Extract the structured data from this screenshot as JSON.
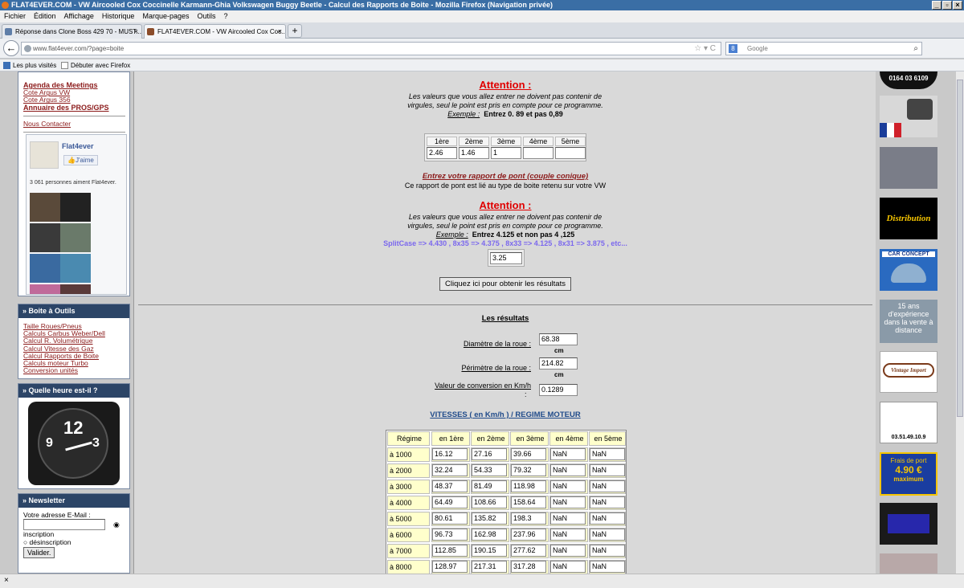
{
  "window": {
    "title": "FLAT4EVER.COM - VW Aircooled Cox Coccinelle Karmann-Ghia Volkswagen Buggy Beetle - Calcul des Rapports de Boite - Mozilla Firefox (Navigation privée)"
  },
  "menu": [
    "Fichier",
    "Édition",
    "Affichage",
    "Historique",
    "Marque-pages",
    "Outils",
    "?"
  ],
  "tabs": [
    "Réponse dans Clone Boss 429 70 - MUST...",
    "FLAT4EVER.COM - VW Aircooled Cox Coc..."
  ],
  "nav": {
    "url": "www.flat4ever.com/?page=boite",
    "search_placeholder": "Google"
  },
  "bookmarks": [
    "Les plus visités",
    "Débuter avec Firefox"
  ],
  "left": {
    "links_top": [
      "Agenda des Meetings",
      "Cote Argus VW",
      "Cote Argus 356",
      "Annuaire des PROS/GPS",
      "Nous Contacter"
    ],
    "fb_name": "Flat4ever",
    "fb_like": "J'aime",
    "fb_count": "3 061 personnes aiment Flat4ever.",
    "tools_title": "» Boite à Outils",
    "tools": [
      "Taille Roues/Pneus",
      "Calculs Carbus Weber/Dell",
      "Calcul R. Volumétrique",
      "Calcul Vitesse des Gaz",
      "Calcul Rapports de Boite",
      "Calculs moteur Turbo",
      "Conversion unités"
    ],
    "time_title": "» Quelle heure est-il ?",
    "news_title": "» Newsletter",
    "news_email": "Votre adresse E-Mail :",
    "news_inscr": "inscription",
    "news_desinscr": "désinscription",
    "news_btn": "Valider."
  },
  "main": {
    "att1": "Attention :",
    "msg1a": "Les valeurs que vous allez entrer ne doivent pas contenir de",
    "msg1b": "virgules, seul le point est pris en compte pour ce programme.",
    "ex1_label": "Exemple :",
    "ex1_text": "Entrez 0. 89 et pas 0,89",
    "gears": [
      "1ère",
      "2ème",
      "3ème",
      "4ème",
      "5ème"
    ],
    "gear_vals": [
      "2.46",
      "1.46",
      "1",
      "",
      ""
    ],
    "pont_title": "Entrez votre rapport de pont (couple conique)",
    "pont_sub": "Ce rapport de pont est lié au type de boite retenu sur votre VW",
    "att2": "Attention :",
    "msg2a": "Les valeurs que vous allez entrer ne doivent pas contenir de",
    "msg2b": "virgules, seul le point est pris en compte pour ce programme.",
    "ex2_label": "Exemple :",
    "ex2_text": "Entrez 4.125 et non pas 4 ,125",
    "splitcase": "SplitCase => 4.430 , 8x35 => 4.375 , 8x33 => 4.125 , 8x31 => 3.875 , etc...",
    "pont_val": "3.25",
    "btn": "Cliquez ici pour obtenir les résultats",
    "res_title": "Les résultats",
    "diam_label": "Diamètre de la roue :",
    "diam_val": "68.38",
    "cm1": "cm",
    "perim_label": "Périmètre de la roue :",
    "perim_val": "214.82",
    "cm2": "cm",
    "conv_label": "Valeur de conversion en Km/h",
    "conv_colon": ":",
    "conv_val": "0.1289",
    "vit_title": "VITESSES ( en Km/h ) / REGIME MOTEUR",
    "headers": [
      "Régime",
      "en 1ère",
      "en 2ème",
      "en 3ème",
      "en 4ème",
      "en 5ème"
    ],
    "rows": [
      [
        "à 1000 RPM",
        "16.12",
        "27.16",
        "39.66",
        "NaN",
        "NaN"
      ],
      [
        "à 2000 RPM",
        "32.24",
        "54.33",
        "79.32",
        "NaN",
        "NaN"
      ],
      [
        "à 3000 RPM",
        "48.37",
        "81.49",
        "118.98",
        "NaN",
        "NaN"
      ],
      [
        "à 4000 RPM",
        "64.49",
        "108.66",
        "158.64",
        "NaN",
        "NaN"
      ],
      [
        "à 5000 RPM",
        "80.61",
        "135.82",
        "198.3",
        "NaN",
        "NaN"
      ],
      [
        "à 6000 RPM",
        "96.73",
        "162.98",
        "237.96",
        "NaN",
        "NaN"
      ],
      [
        "à 7000 RPM",
        "112.85",
        "190.15",
        "277.62",
        "NaN",
        "NaN"
      ],
      [
        "à 8000 RPM",
        "128.97",
        "217.31",
        "317.28",
        "NaN",
        "NaN"
      ]
    ]
  },
  "right": {
    "exp": "15 ans d'expérience dans la vente à distance",
    "frais": "Frais de port",
    "price": "4.90 €",
    "max": "maximum",
    "car_concept": "CAR CONCEPT",
    "distribution": "Distribution",
    "vintage": "Vintage Import",
    "phone": "0164 03 6109",
    "ad_phone": "03.51.49.10.9"
  },
  "status": "×"
}
